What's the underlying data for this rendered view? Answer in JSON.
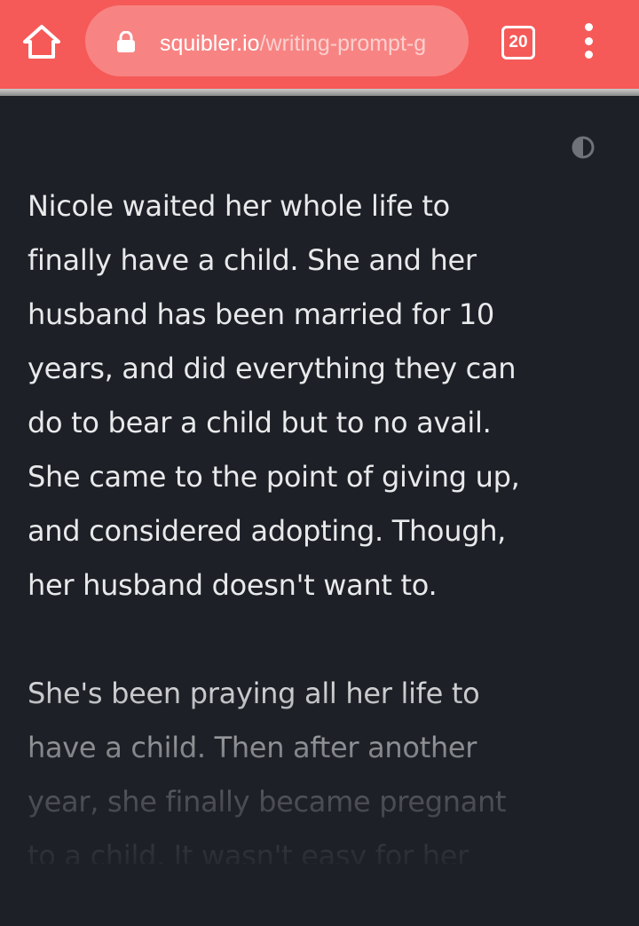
{
  "browser": {
    "url_host": "squibler.io",
    "url_path": "/writing-prompt-g",
    "tab_count": "20",
    "icons": {
      "home": "home-icon",
      "lock": "lock-icon",
      "tabs": "tabs-icon",
      "menu": "more-vert-icon"
    },
    "colors": {
      "toolbar": "#f55a58",
      "url_box": "#f78483"
    }
  },
  "page": {
    "theme_toggle_icon": "contrast-icon",
    "background": "#1d2026",
    "text_color": "#e8e9eb",
    "paragraphs": [
      "Nicole waited her whole life to\nfinally have a child. She and her\nhusband has been married for 10\nyears, and did everything they can\ndo to bear a child but to no avail.\nShe came to the point of giving up,\nand considered adopting. Though,\nher husband doesn't want to.",
      "She's been praying all her life to\nhave a child. Then after another\nyear, she finally became pregnant\nto a child. It wasn't easy for her"
    ]
  }
}
